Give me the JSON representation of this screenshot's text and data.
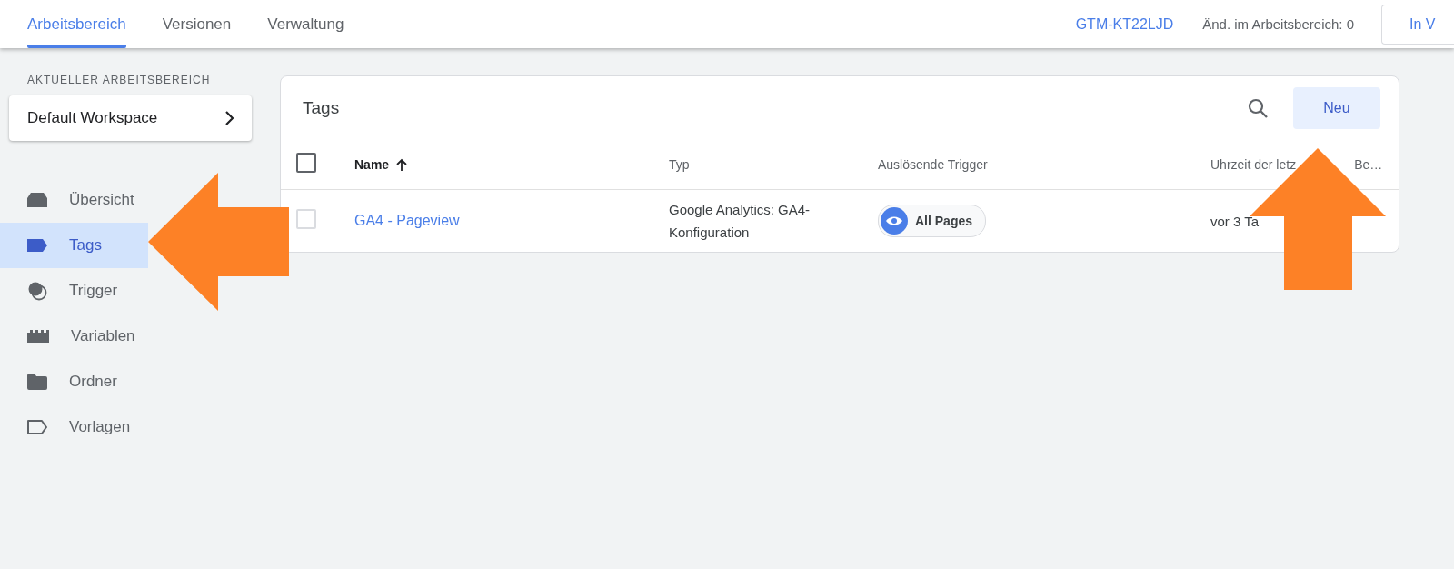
{
  "top_tabs": [
    {
      "label": "Arbeitsbereich",
      "selected": true
    },
    {
      "label": "Versionen",
      "selected": false
    },
    {
      "label": "Verwaltung",
      "selected": false
    }
  ],
  "container_id": "GTM-KT22LJD",
  "changes": "Änd. im Arbeitsbereich: 0",
  "preview_button": "In V",
  "sidebar": {
    "section_label": "AKTUELLER ARBEITSBEREICH",
    "workspace": "Default Workspace",
    "items": [
      {
        "label": "Übersicht",
        "kind": "overview",
        "selected": false
      },
      {
        "label": "Tags",
        "kind": "tag",
        "selected": true
      },
      {
        "label": "Trigger",
        "kind": "trigger",
        "selected": false
      },
      {
        "label": "Variablen",
        "kind": "variable",
        "selected": false
      },
      {
        "label": "Ordner",
        "kind": "folder",
        "selected": false
      },
      {
        "label": "Vorlagen",
        "kind": "template",
        "selected": false
      }
    ]
  },
  "card": {
    "title": "Tags",
    "new_button": "Neu",
    "select_all_checked": false,
    "columns": [
      {
        "label": "Name",
        "sorted": true
      },
      {
        "label": "Typ",
        "sorted": false
      },
      {
        "label": "Auslösende Trigger",
        "sorted": false
      },
      {
        "label": "Uhrzeit der letz",
        "label_end": "Be…",
        "sorted": false
      }
    ],
    "rows": [
      {
        "checked": false,
        "name": "GA4 - Pageview",
        "type": "Google Analytics: GA4-Konfiguration",
        "trigger": "All Pages",
        "time": "vor 3 Ta"
      }
    ]
  },
  "annotations": [
    {
      "kind": "arrow_left"
    },
    {
      "kind": "arrow_up"
    }
  ]
}
